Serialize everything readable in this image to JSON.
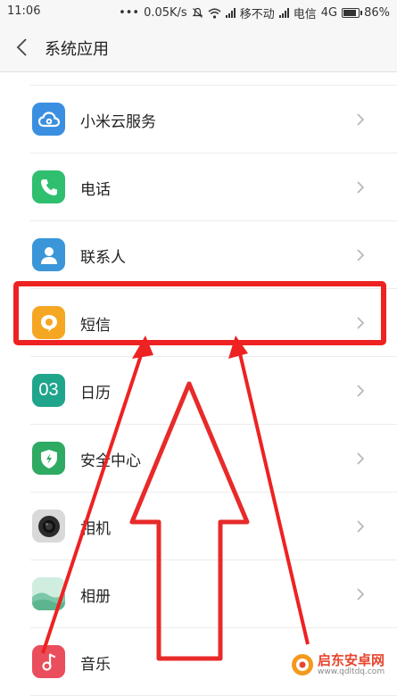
{
  "status_bar": {
    "time": "11:06",
    "dots": "•••",
    "speed": "0.05K/s",
    "carrier1": "移不动",
    "carrier2": "电信",
    "network": "4G",
    "battery": "86%"
  },
  "header": {
    "title": "系统应用"
  },
  "list": {
    "items": [
      {
        "label": "小米云服务",
        "icon": "cloud-icon",
        "color": "#3a8fe0"
      },
      {
        "label": "电话",
        "icon": "phone-icon",
        "color": "#2fbf6f"
      },
      {
        "label": "联系人",
        "icon": "contact-icon",
        "color": "#3a96d8"
      },
      {
        "label": "短信",
        "icon": "message-icon",
        "color": "#f5a623"
      },
      {
        "label": "日历",
        "icon": "calendar-icon",
        "color": "#1fa58c",
        "glyph": "03"
      },
      {
        "label": "安全中心",
        "icon": "shield-icon",
        "color": "#2eaa62"
      },
      {
        "label": "相机",
        "icon": "camera-icon",
        "color": "#d9d9d9"
      },
      {
        "label": "相册",
        "icon": "gallery-icon",
        "color": "#7cc7a8"
      },
      {
        "label": "音乐",
        "icon": "music-icon",
        "color": "#ea4d5b"
      }
    ]
  },
  "annotation": {
    "color": "#ee2222"
  },
  "watermark": {
    "text": "启东安卓网",
    "url": "www.qdltdq.com"
  }
}
